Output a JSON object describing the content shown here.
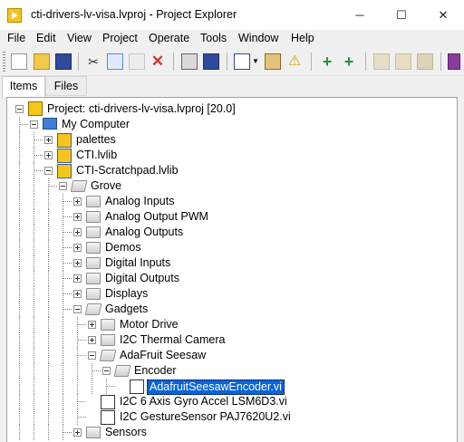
{
  "window": {
    "title": "cti-drivers-lv-visa.lvproj - Project Explorer",
    "minimize": "─",
    "maximize": "☐",
    "close": "✕"
  },
  "menu": [
    "File",
    "Edit",
    "View",
    "Project",
    "Operate",
    "Tools",
    "Window",
    "Help"
  ],
  "toolbar": {
    "icons": [
      "new-icon",
      "open-icon",
      "save-all-icon",
      "cut-icon",
      "copy-icon",
      "paste-icon",
      "delete-icon",
      "build-icon",
      "save-icon",
      "view-icon",
      "dropdown-arrow-icon",
      "hierarchy-icon",
      "warning-icon",
      "add-icon",
      "add-green-icon",
      "build-spec-icon",
      "folder-sync-icon",
      "package-icon",
      "extra-icon"
    ]
  },
  "tabs": [
    {
      "label": "Items",
      "active": true
    },
    {
      "label": "Files",
      "active": false
    }
  ],
  "tree": [
    {
      "label": "Project: cti-drivers-lv-visa.lvproj [20.0]",
      "depth": 0,
      "icon": "project-icon",
      "expander": "minus"
    },
    {
      "label": "My Computer",
      "depth": 1,
      "icon": "computer-icon",
      "expander": "minus"
    },
    {
      "label": "palettes",
      "depth": 2,
      "icon": "library-icon",
      "expander": "plus"
    },
    {
      "label": "CTI.lvlib",
      "depth": 2,
      "icon": "library-icon",
      "expander": "plus"
    },
    {
      "label": "CTI-Scratchpad.lvlib",
      "depth": 2,
      "icon": "library-icon",
      "expander": "minus"
    },
    {
      "label": "Grove",
      "depth": 3,
      "icon": "folder-open-icon",
      "expander": "minus"
    },
    {
      "label": "Analog Inputs",
      "depth": 4,
      "icon": "folder-icon",
      "expander": "plus"
    },
    {
      "label": "Analog Output PWM",
      "depth": 4,
      "icon": "folder-icon",
      "expander": "plus"
    },
    {
      "label": "Analog Outputs",
      "depth": 4,
      "icon": "folder-icon",
      "expander": "plus"
    },
    {
      "label": "Demos",
      "depth": 4,
      "icon": "folder-icon",
      "expander": "plus"
    },
    {
      "label": "Digital Inputs",
      "depth": 4,
      "icon": "folder-icon",
      "expander": "plus"
    },
    {
      "label": "Digital Outputs",
      "depth": 4,
      "icon": "folder-icon",
      "expander": "plus"
    },
    {
      "label": "Displays",
      "depth": 4,
      "icon": "folder-icon",
      "expander": "plus"
    },
    {
      "label": "Gadgets",
      "depth": 4,
      "icon": "folder-open-icon",
      "expander": "minus"
    },
    {
      "label": "Motor Drive",
      "depth": 5,
      "icon": "folder-icon",
      "expander": "plus"
    },
    {
      "label": "I2C Thermal Camera",
      "depth": 5,
      "icon": "folder-icon",
      "expander": "plus"
    },
    {
      "label": "AdaFruit Seesaw",
      "depth": 5,
      "icon": "folder-open-icon",
      "expander": "minus"
    },
    {
      "label": "Encoder",
      "depth": 6,
      "icon": "folder-open-icon",
      "expander": "minus"
    },
    {
      "label": "AdafruitSeesawEncoder.vi",
      "depth": 7,
      "icon": "vi-icon",
      "expander": "none",
      "selected": true
    },
    {
      "label": "I2C 6 Axis Gyro Accel LSM6D3.vi",
      "depth": 5,
      "icon": "vi-icon",
      "expander": "none"
    },
    {
      "label": "I2C GestureSensor PAJ7620U2.vi",
      "depth": 5,
      "icon": "vi-icon",
      "expander": "none"
    },
    {
      "label": "Sensors",
      "depth": 4,
      "icon": "folder-icon",
      "expander": "plus"
    }
  ],
  "colors": {
    "selection": "#0a64d8",
    "accent": "#f5c518"
  }
}
